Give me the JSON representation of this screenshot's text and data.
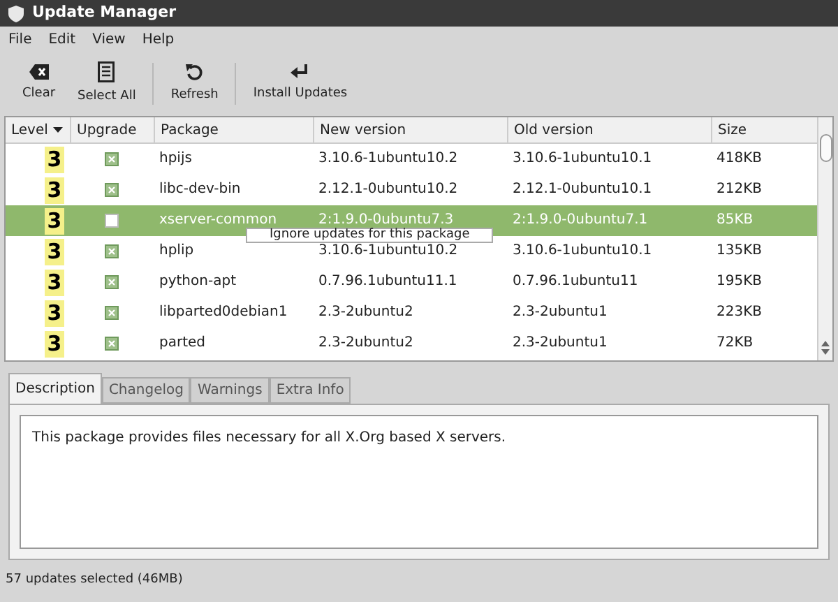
{
  "window": {
    "title": "Update Manager"
  },
  "menu": [
    "File",
    "Edit",
    "View",
    "Help"
  ],
  "toolbar": [
    {
      "kind": "clear",
      "label": "Clear"
    },
    {
      "kind": "selectall",
      "label": "Select All"
    },
    {
      "kind": "refresh",
      "label": "Refresh"
    },
    {
      "kind": "install",
      "label": "Install Updates"
    }
  ],
  "table": {
    "columns": [
      "Level",
      "Upgrade",
      "Package",
      "New version",
      "Old version",
      "Size"
    ],
    "rows": [
      {
        "level": "3",
        "checked": true,
        "selected": false,
        "package": "hpijs",
        "new": "3.10.6-1ubuntu10.2",
        "old": "3.10.6-1ubuntu10.1",
        "size": "418KB"
      },
      {
        "level": "3",
        "checked": true,
        "selected": false,
        "package": "libc-dev-bin",
        "new": "2.12.1-0ubuntu10.2",
        "old": "2.12.1-0ubuntu10.1",
        "size": "212KB"
      },
      {
        "level": "3",
        "checked": false,
        "selected": true,
        "package": "xserver-common",
        "new": "2:1.9.0-0ubuntu7.3",
        "old": "2:1.9.0-0ubuntu7.1",
        "size": "85KB"
      },
      {
        "level": "3",
        "checked": true,
        "selected": false,
        "package": "hplip",
        "new": "3.10.6-1ubuntu10.2",
        "old": "3.10.6-1ubuntu10.1",
        "size": "135KB"
      },
      {
        "level": "3",
        "checked": true,
        "selected": false,
        "package": "python-apt",
        "new": "0.7.96.1ubuntu11.1",
        "old": "0.7.96.1ubuntu11",
        "size": "195KB"
      },
      {
        "level": "3",
        "checked": true,
        "selected": false,
        "package": "libparted0debian1",
        "new": "2.3-2ubuntu2",
        "old": "2.3-2ubuntu1",
        "size": "223KB"
      },
      {
        "level": "3",
        "checked": true,
        "selected": false,
        "package": "parted",
        "new": "2.3-2ubuntu2",
        "old": "2.3-2ubuntu1",
        "size": "72KB"
      }
    ]
  },
  "popup": {
    "label": "Ignore updates for this package"
  },
  "tabs": [
    {
      "label": "Description",
      "selected": true
    },
    {
      "label": "Changelog",
      "selected": false
    },
    {
      "label": "Warnings",
      "selected": false
    },
    {
      "label": "Extra Info",
      "selected": false
    }
  ],
  "description": "This package provides files necessary for all X.Org based X servers.",
  "status_bar": "57 updates selected (46MB)"
}
